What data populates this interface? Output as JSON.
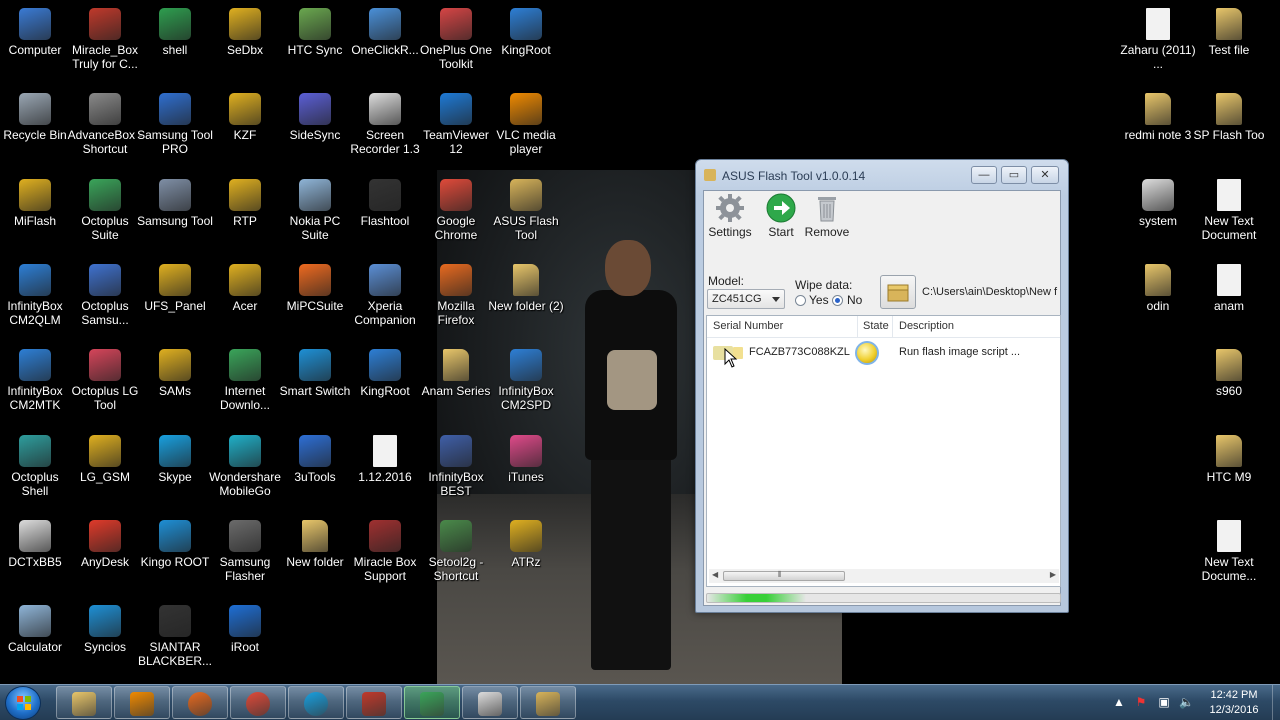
{
  "desktop": {
    "icons_left": [
      {
        "label": "Computer",
        "icon": "computer-icon",
        "color": "#3a7bd5"
      },
      {
        "label": "Miracle_Box Truly for C...",
        "icon": "miracle-box-icon",
        "color": "#c0392b"
      },
      {
        "label": "shell",
        "icon": "shell-icon",
        "color": "#2e9e4f"
      },
      {
        "label": "SeDbx",
        "icon": "app-icon",
        "color": "#e0b020"
      },
      {
        "label": "HTC Sync",
        "icon": "htc-sync-icon",
        "color": "#6aa84f"
      },
      {
        "label": "OneClickR...",
        "icon": "oneclick-icon",
        "color": "#4a90d9"
      },
      {
        "label": "OnePlus One Toolkit",
        "icon": "oneplus-icon",
        "color": "#d64545"
      },
      {
        "label": "KingRoot",
        "icon": "kingroot-icon",
        "color": "#2d7fd6"
      },
      {
        "label": "Recycle Bin",
        "icon": "recycle-bin-icon",
        "color": "#9aa7b4"
      },
      {
        "label": "AdvanceBox - Shortcut",
        "icon": "advancebox-icon",
        "color": "#8a8a8a"
      },
      {
        "label": "Samsung Tool PRO",
        "icon": "samsung-tool-icon",
        "color": "#2f6fd0"
      },
      {
        "label": "KZF",
        "icon": "app-icon",
        "color": "#e0b020"
      },
      {
        "label": "SideSync",
        "icon": "sidesync-icon",
        "color": "#5b5fd6"
      },
      {
        "label": "Screen Recorder 1.3",
        "icon": "screen-recorder-icon",
        "color": "#dddddd"
      },
      {
        "label": "TeamViewer 12",
        "icon": "teamviewer-icon",
        "color": "#1e7ad6"
      },
      {
        "label": "VLC media player",
        "icon": "vlc-icon",
        "color": "#f08a00"
      },
      {
        "label": "MiFlash",
        "icon": "miflash-icon",
        "color": "#e0b020"
      },
      {
        "label": "Octoplus Suite",
        "icon": "octoplus-icon",
        "color": "#3aa55a"
      },
      {
        "label": "Samsung Tool",
        "icon": "gear-icon",
        "color": "#7f8fa6"
      },
      {
        "label": "RTP",
        "icon": "app-icon",
        "color": "#e0b020"
      },
      {
        "label": "Nokia PC Suite",
        "icon": "nokia-icon",
        "color": "#8fb5d8"
      },
      {
        "label": "Flashtool",
        "icon": "flashtool-icon",
        "color": "#333333"
      },
      {
        "label": "Google Chrome",
        "icon": "chrome-icon",
        "color": "#e04a3a"
      },
      {
        "label": "ASUS Flash Tool",
        "icon": "box-icon",
        "color": "#d8b45a"
      },
      {
        "label": "InfinityBox CM2QLM",
        "icon": "infinitybox-icon",
        "color": "#2d7fd6"
      },
      {
        "label": "Octoplus Samsu...",
        "icon": "octoplus-icon",
        "color": "#3f72d0"
      },
      {
        "label": "UFS_Panel",
        "icon": "app-icon",
        "color": "#e0b020"
      },
      {
        "label": "Acer",
        "icon": "app-icon",
        "color": "#e0b020"
      },
      {
        "label": "MiPCSuite",
        "icon": "mi-icon",
        "color": "#ef6a1f"
      },
      {
        "label": "Xperia Companion",
        "icon": "xperia-icon",
        "color": "#5b8fd6"
      },
      {
        "label": "Mozilla Firefox",
        "icon": "firefox-icon",
        "color": "#e86a1f"
      },
      {
        "label": "New folder (2)",
        "icon": "folder-icon",
        "color": "#e8c66a"
      },
      {
        "label": "InfinityBox CM2MTK",
        "icon": "infinitybox-icon",
        "color": "#2d7fd6"
      },
      {
        "label": "Octoplus LG Tool",
        "icon": "octoplus-icon",
        "color": "#d6455a"
      },
      {
        "label": "SAMs",
        "icon": "app-icon",
        "color": "#e0b020"
      },
      {
        "label": "Internet Downlo...",
        "icon": "idm-icon",
        "color": "#3aa55a"
      },
      {
        "label": "Smart Switch",
        "icon": "smart-switch-icon",
        "color": "#1e90d6"
      },
      {
        "label": "KingRoot",
        "icon": "kingroot-icon",
        "color": "#2d7fd6"
      },
      {
        "label": "Anam Series",
        "icon": "folder-icon",
        "color": "#e8c66a"
      },
      {
        "label": "InfinityBox CM2SPD",
        "icon": "infinitybox-icon",
        "color": "#2d7fd6"
      },
      {
        "label": "Octoplus Shell",
        "icon": "octoplus-icon",
        "color": "#2e9e9e"
      },
      {
        "label": "LG_GSM",
        "icon": "app-icon",
        "color": "#e0b020"
      },
      {
        "label": "Skype",
        "icon": "skype-icon",
        "color": "#18a0e0"
      },
      {
        "label": "Wondershare MobileGo",
        "icon": "mobilego-icon",
        "color": "#1fb0c9"
      },
      {
        "label": "3uTools",
        "icon": "3utools-icon",
        "color": "#2d6fd6"
      },
      {
        "label": "1.12.2016",
        "icon": "document-icon",
        "color": "#f2f2f2"
      },
      {
        "label": "InfinityBox BEST",
        "icon": "infinitybox-icon",
        "color": "#3f5fa8"
      },
      {
        "label": "iTunes",
        "icon": "itunes-icon",
        "color": "#e04a8a"
      },
      {
        "label": "DCTxBB5",
        "icon": "dct-icon",
        "color": "#dddddd"
      },
      {
        "label": "AnyDesk",
        "icon": "anydesk-icon",
        "color": "#e03a2a"
      },
      {
        "label": "Kingo ROOT",
        "icon": "kingo-icon",
        "color": "#1e8fd6"
      },
      {
        "label": "Samsung Flasher",
        "icon": "samsung-flasher-icon",
        "color": "#6b6b6b"
      },
      {
        "label": "New folder",
        "icon": "folder-icon",
        "color": "#e8c66a"
      },
      {
        "label": "Miracle Box Support",
        "icon": "miracle-box-icon",
        "color": "#a03030"
      },
      {
        "label": "Setool2g - Shortcut",
        "icon": "setool-icon",
        "color": "#4a8a4a"
      },
      {
        "label": "ATRz",
        "icon": "app-icon",
        "color": "#e0b020"
      },
      {
        "label": "Calculator",
        "icon": "calculator-icon",
        "color": "#8fb5d8"
      },
      {
        "label": "Syncios",
        "icon": "syncios-icon",
        "color": "#1e90d6"
      },
      {
        "label": "SIANTAR BLACKBER...",
        "icon": "blackberry-icon",
        "color": "#333333"
      },
      {
        "label": "iRoot",
        "icon": "iroot-icon",
        "color": "#1e6fd6"
      }
    ],
    "icons_right": [
      {
        "label": "Zaharu (2011) ...",
        "icon": "document-icon",
        "color": "#f2f2f2"
      },
      {
        "label": "Test file",
        "icon": "folder-icon",
        "color": "#e8c66a"
      },
      {
        "label": "redmi note 3",
        "icon": "folder-icon",
        "color": "#e8c66a"
      },
      {
        "label": "SP Flash Too",
        "icon": "folder-icon",
        "color": "#e8c66a"
      },
      {
        "label": "system",
        "icon": "system-file-icon",
        "color": "#dddddd"
      },
      {
        "label": "New Text Document",
        "icon": "text-document-icon",
        "color": "#f2f2f2"
      },
      {
        "label": "odin",
        "icon": "folder-icon",
        "color": "#e8c66a"
      },
      {
        "label": "anam",
        "icon": "text-document-icon",
        "color": "#f2f2f2"
      },
      {
        "label": "s960",
        "icon": "folder-icon",
        "color": "#e8c66a"
      },
      {
        "label": "HTC M9",
        "icon": "folder-icon",
        "color": "#e8c66a"
      },
      {
        "label": "New Text Docume...",
        "icon": "text-document-icon",
        "color": "#f2f2f2"
      }
    ]
  },
  "window": {
    "title": "ASUS Flash Tool v1.0.0.14",
    "minimize_glyph": "—",
    "maximize_glyph": "▭",
    "close_glyph": "✕",
    "toolbar": {
      "settings_label": "Settings",
      "start_label": "Start",
      "remove_label": "Remove"
    },
    "model_label": "Model:",
    "model_value": "ZC451CG",
    "wipe_label": "Wipe data:",
    "wipe_yes": "Yes",
    "wipe_no": "No",
    "wipe_selected": "No",
    "path_value": "C:\\Users\\ain\\Desktop\\New f",
    "columns": [
      "Serial Number",
      "State",
      "Description"
    ],
    "rows": [
      {
        "serial": "FCAZB773C088KZL",
        "state_color": "#f0d030",
        "description": "Run flash image script ..."
      }
    ],
    "progress_fraction": 0.28,
    "scroll_left_glyph": "◀",
    "scroll_right_glyph": "▶",
    "scroll_thumb_grip": "⦀"
  },
  "taskbar": {
    "items": [
      {
        "name": "explorer",
        "icon": "folder-icon",
        "color": "#e8c66a",
        "active": false
      },
      {
        "name": "media-player",
        "icon": "media-player-icon",
        "color": "#f08a00",
        "active": false
      },
      {
        "name": "firefox",
        "icon": "firefox-icon",
        "color": "#e86a1f",
        "active": false
      },
      {
        "name": "chrome",
        "icon": "chrome-icon",
        "color": "#e04a3a",
        "active": false
      },
      {
        "name": "skype",
        "icon": "skype-icon",
        "color": "#18a0e0",
        "active": false
      },
      {
        "name": "toolbox",
        "icon": "toolbox-icon",
        "color": "#c0392b",
        "active": false
      },
      {
        "name": "idm",
        "icon": "idm-icon",
        "color": "#3aa55a",
        "active": true
      },
      {
        "name": "screen-recorder",
        "icon": "screen-recorder-icon",
        "color": "#dddddd",
        "active": false
      },
      {
        "name": "asus-flash-tool",
        "icon": "box-icon",
        "color": "#d8b45a",
        "active": false
      }
    ],
    "tray": {
      "show_hidden_glyph": "▲",
      "flag_glyph": "⚑",
      "network_glyph": "▣",
      "volume_glyph": "🔈"
    },
    "time": "12:42 PM",
    "date": "12/3/2016"
  }
}
